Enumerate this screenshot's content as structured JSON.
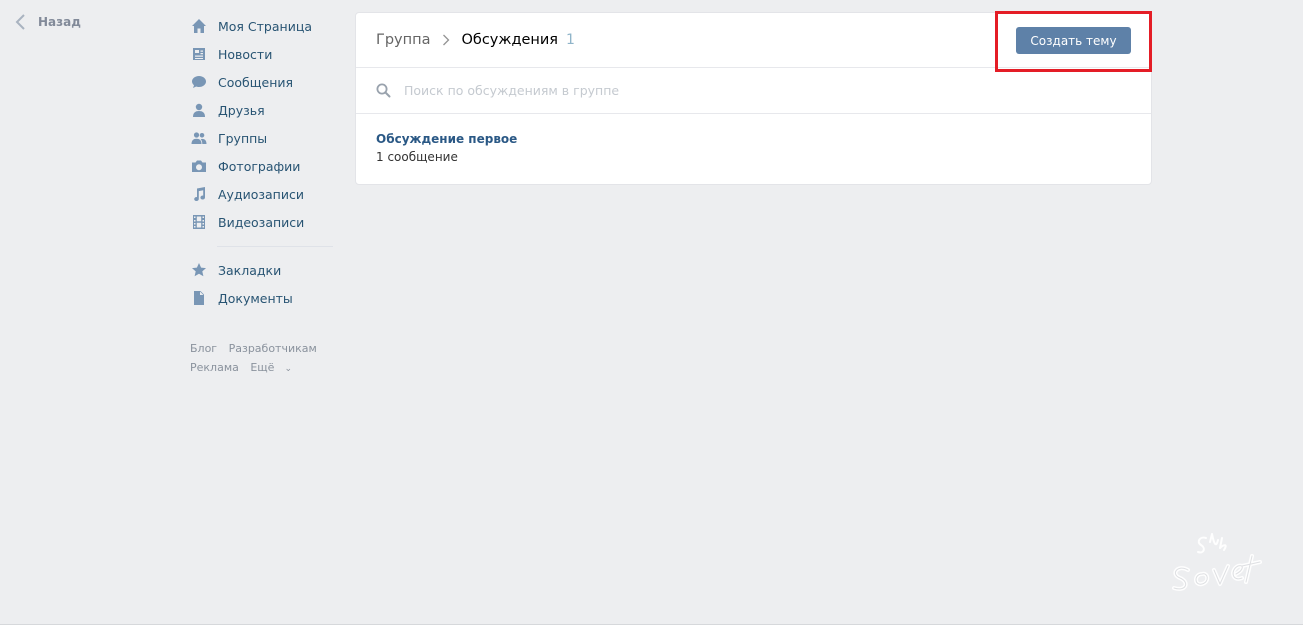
{
  "back": {
    "label": "Назад"
  },
  "sidebar": {
    "items": [
      {
        "label": "Моя Страница",
        "icon": "home-icon"
      },
      {
        "label": "Новости",
        "icon": "news-icon"
      },
      {
        "label": "Сообщения",
        "icon": "messages-icon"
      },
      {
        "label": "Друзья",
        "icon": "friends-icon"
      },
      {
        "label": "Группы",
        "icon": "groups-icon"
      },
      {
        "label": "Фотографии",
        "icon": "camera-icon"
      },
      {
        "label": "Аудиозаписи",
        "icon": "music-icon"
      },
      {
        "label": "Видеозаписи",
        "icon": "film-icon"
      }
    ],
    "extra_items": [
      {
        "label": "Закладки",
        "icon": "star-icon"
      },
      {
        "label": "Документы",
        "icon": "document-icon"
      }
    ],
    "footer": {
      "blog": "Блог",
      "developers": "Разработчикам",
      "ads": "Реклама",
      "more": "Ещё"
    }
  },
  "header": {
    "crumb_group": "Группа",
    "crumb_current": "Обсуждения",
    "count": "1",
    "create_button": "Создать тему"
  },
  "search": {
    "placeholder": "Поиск по обсуждениям в группе"
  },
  "topics": [
    {
      "title": "Обсуждение первое",
      "count": "1 сообщение"
    }
  ],
  "colors": {
    "background": "#edeef0",
    "link": "#2a5885",
    "button": "#5e81a8",
    "highlight": "#e41d26"
  }
}
